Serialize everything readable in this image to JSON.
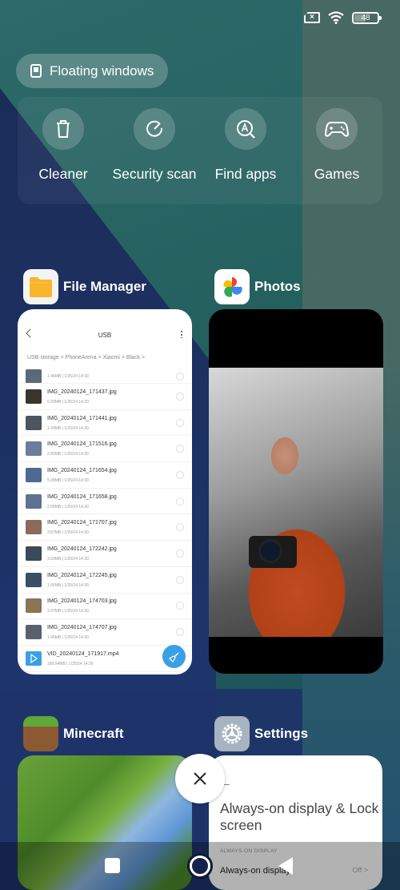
{
  "status_bar": {
    "sim_icon": "no-sim-icon",
    "wifi_icon": "wifi-icon",
    "battery_level": "48"
  },
  "floating_windows": {
    "label": "Floating windows",
    "icon": "floating-window-icon"
  },
  "quick_tools": [
    {
      "label": "Cleaner",
      "icon": "trash-icon"
    },
    {
      "label": "Security scan",
      "icon": "security-scan-icon"
    },
    {
      "label": "Find apps",
      "icon": "find-apps-icon"
    },
    {
      "label": "Games",
      "icon": "gamepad-icon"
    }
  ],
  "apps": {
    "file_manager": {
      "name": "File Manager",
      "screen": {
        "title": "USB",
        "breadcrumb": "USB storage  >  PhoneArena  >  Xiaomi  >  Black  >",
        "files": [
          {
            "name": "",
            "meta": "1.46MB  |  1/25/24 14:30"
          },
          {
            "name": "IMG_20240124_171437.jpg",
            "meta": "5.09MB  |  1/25/24 14:30"
          },
          {
            "name": "IMG_20240124_171441.jpg",
            "meta": "1.49MB  |  1/25/24 14:30"
          },
          {
            "name": "IMG_20240124_171516.jpg",
            "meta": "2.85MB  |  1/25/24 14:30"
          },
          {
            "name": "IMG_20240124_171654.jpg",
            "meta": "5.08MB  |  1/25/24 14:30"
          },
          {
            "name": "IMG_20240124_171658.jpg",
            "meta": "2.06MB  |  1/25/24 14:30"
          },
          {
            "name": "IMG_20240124_171707.jpg",
            "meta": "3.87MB  |  1/25/24 14:30"
          },
          {
            "name": "IMG_20240124_172242.jpg",
            "meta": "3.69MB  |  1/25/24 14:30"
          },
          {
            "name": "IMG_20240124_172245.jpg",
            "meta": "1.65MB  |  1/25/24 14:30"
          },
          {
            "name": "IMG_20240124_174703.jpg",
            "meta": "3.47MB  |  1/25/24 14:30"
          },
          {
            "name": "IMG_20240124_174707.jpg",
            "meta": "1.45MB  |  1/25/24 14:30"
          },
          {
            "name": "VID_20240124_171917.mp4",
            "meta": "189.94MB  |  1/25/24 14:29"
          }
        ]
      }
    },
    "photos": {
      "name": "Photos"
    },
    "minecraft": {
      "name": "Minecraft"
    },
    "settings": {
      "name": "Settings",
      "screen": {
        "title": "Always-on display & Lock screen",
        "section": "ALWAYS-ON DISPLAY",
        "row_label": "Always-on display",
        "row_value": "Off"
      }
    }
  },
  "colors": {
    "fab": "#3aa0e6",
    "folder": "#f9b52b"
  },
  "nav": {
    "recents": "recents-icon",
    "home": "home-icon",
    "back": "back-icon"
  }
}
